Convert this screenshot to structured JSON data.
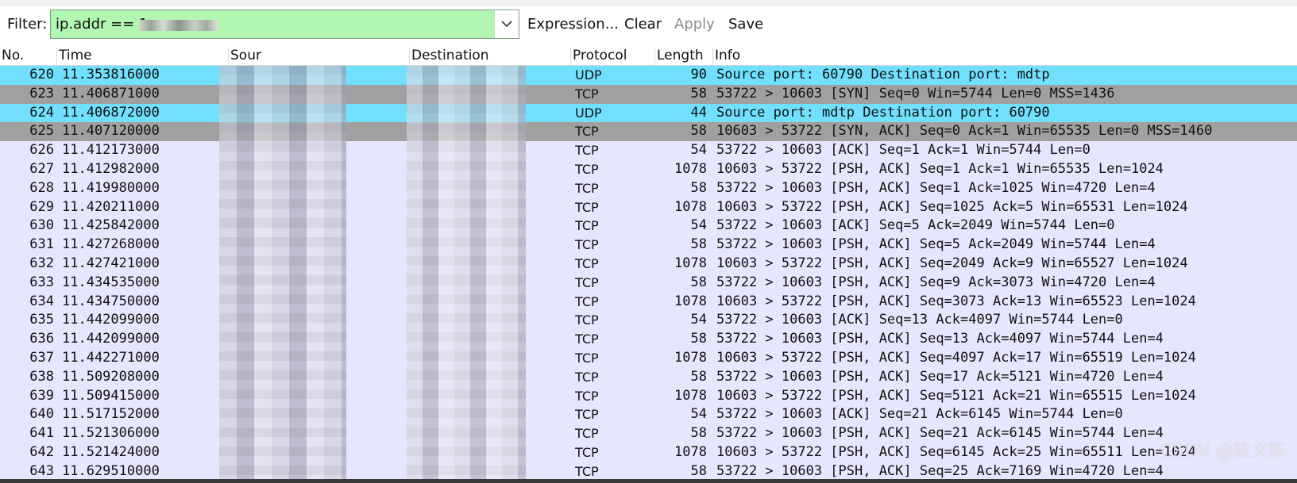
{
  "toolbar": {
    "filter_label": "Filter:",
    "filter_value": "ip.addr == 1",
    "expression_label": "Expression...",
    "clear_label": "Clear",
    "apply_label": "Apply",
    "save_label": "Save"
  },
  "columns": {
    "no": "No.",
    "time": "Time",
    "source": "Sour",
    "destination": "Destination",
    "protocol": "Protocol",
    "length": "Length",
    "info": "Info"
  },
  "packets": [
    {
      "no": "620",
      "time": "11.353816000",
      "protocol": "UDP",
      "length": "90",
      "info": "Source port: 60790  Destination port: mdtp"
    },
    {
      "no": "623",
      "time": "11.406871000",
      "protocol": "TCP",
      "length": "58",
      "info": "53722 > 10603 [SYN] Seq=0 Win=5744 Len=0 MSS=1436"
    },
    {
      "no": "624",
      "time": "11.406872000",
      "protocol": "UDP",
      "length": "44",
      "info": "Source port: mdtp  Destination port: 60790"
    },
    {
      "no": "625",
      "time": "11.407120000",
      "protocol": "TCP",
      "length": "58",
      "info": "10603 > 53722 [SYN, ACK] Seq=0 Ack=1 Win=65535 Len=0 MSS=1460"
    },
    {
      "no": "626",
      "time": "11.412173000",
      "protocol": "TCP",
      "length": "54",
      "info": "53722 > 10603 [ACK] Seq=1 Ack=1 Win=5744 Len=0"
    },
    {
      "no": "627",
      "time": "11.412982000",
      "protocol": "TCP",
      "length": "1078",
      "info": "10603 > 53722 [PSH, ACK] Seq=1 Ack=1 Win=65535 Len=1024"
    },
    {
      "no": "628",
      "time": "11.419980000",
      "protocol": "TCP",
      "length": "58",
      "info": "53722 > 10603 [PSH, ACK] Seq=1 Ack=1025 Win=4720 Len=4"
    },
    {
      "no": "629",
      "time": "11.420211000",
      "protocol": "TCP",
      "length": "1078",
      "info": "10603 > 53722 [PSH, ACK] Seq=1025 Ack=5 Win=65531 Len=1024"
    },
    {
      "no": "630",
      "time": "11.425842000",
      "protocol": "TCP",
      "length": "54",
      "info": "53722 > 10603 [ACK] Seq=5 Ack=2049 Win=5744 Len=0"
    },
    {
      "no": "631",
      "time": "11.427268000",
      "protocol": "TCP",
      "length": "58",
      "info": "53722 > 10603 [PSH, ACK] Seq=5 Ack=2049 Win=5744 Len=4"
    },
    {
      "no": "632",
      "time": "11.427421000",
      "protocol": "TCP",
      "length": "1078",
      "info": "10603 > 53722 [PSH, ACK] Seq=2049 Ack=9 Win=65527 Len=1024"
    },
    {
      "no": "633",
      "time": "11.434535000",
      "protocol": "TCP",
      "length": "58",
      "info": "53722 > 10603 [PSH, ACK] Seq=9 Ack=3073 Win=4720 Len=4"
    },
    {
      "no": "634",
      "time": "11.434750000",
      "protocol": "TCP",
      "length": "1078",
      "info": "10603 > 53722 [PSH, ACK] Seq=3073 Ack=13 Win=65523 Len=1024"
    },
    {
      "no": "635",
      "time": "11.442099000",
      "protocol": "TCP",
      "length": "54",
      "info": "53722 > 10603 [ACK] Seq=13 Ack=4097 Win=5744 Len=0"
    },
    {
      "no": "636",
      "time": "11.442099000",
      "protocol": "TCP",
      "length": "58",
      "info": "53722 > 10603 [PSH, ACK] Seq=13 Ack=4097 Win=5744 Len=4"
    },
    {
      "no": "637",
      "time": "11.442271000",
      "protocol": "TCP",
      "length": "1078",
      "info": "10603 > 53722 [PSH, ACK] Seq=4097 Ack=17 Win=65519 Len=1024"
    },
    {
      "no": "638",
      "time": "11.509208000",
      "protocol": "TCP",
      "length": "58",
      "info": "53722 > 10603 [PSH, ACK] Seq=17 Ack=5121 Win=4720 Len=4"
    },
    {
      "no": "639",
      "time": "11.509415000",
      "protocol": "TCP",
      "length": "1078",
      "info": "10603 > 53722 [PSH, ACK] Seq=5121 Ack=21 Win=65515 Len=1024"
    },
    {
      "no": "640",
      "time": "11.517152000",
      "protocol": "TCP",
      "length": "54",
      "info": "53722 > 10603 [ACK] Seq=21 Ack=6145 Win=5744 Len=0"
    },
    {
      "no": "641",
      "time": "11.521306000",
      "protocol": "TCP",
      "length": "58",
      "info": "53722 > 10603 [PSH, ACK] Seq=21 Ack=6145 Win=5744 Len=4"
    },
    {
      "no": "642",
      "time": "11.521424000",
      "protocol": "TCP",
      "length": "1078",
      "info": "10603 > 53722 [PSH, ACK] Seq=6145 Ack=25 Win=65511 Len=1024"
    },
    {
      "no": "643",
      "time": "11.629510000",
      "protocol": "TCP",
      "length": "58",
      "info": "53722 > 10603 [PSH, ACK] Seq=25 Ack=7169 Win=4720 Len=4"
    }
  ],
  "row_colors": {
    "udp": "#70e0fe",
    "syn": "#a0a0a0",
    "tcp": "#e7e6ff",
    "filter_valid": "#b1f7b1"
  },
  "watermark": "CSDN @陈义陈"
}
